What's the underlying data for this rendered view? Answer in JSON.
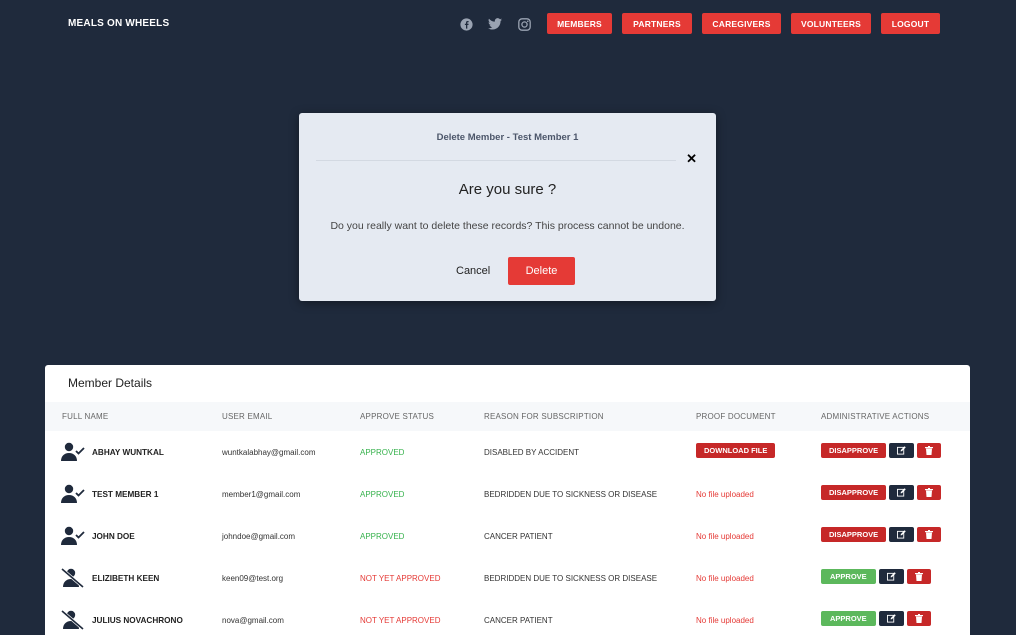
{
  "header": {
    "brand": "MEALS ON WHEELS",
    "social": [
      "facebook-icon",
      "twitter-icon",
      "instagram-icon"
    ],
    "nav": [
      "MEMBERS",
      "PARTNERS",
      "CAREGIVERS",
      "VOLUNTEERS",
      "LOGOUT"
    ]
  },
  "modal": {
    "title": "Delete Member - Test Member 1",
    "question": "Are you sure ?",
    "message": "Do you really want to delete these records? This process cannot be undone.",
    "cancel_label": "Cancel",
    "delete_label": "Delete"
  },
  "table": {
    "title": "Member Details",
    "columns": [
      "FULL NAME",
      "USER EMAIL",
      "APPROVE STATUS",
      "REASON FOR SUBSCRIPTION",
      "PROOF DOCUMENT",
      "ADMINISTRATIVE ACTIONS"
    ],
    "rows": [
      {
        "name": "ABHAY WUNTKAL",
        "email": "wuntkalabhay@gmail.com",
        "status": "APPROVED",
        "reason": "DISABLED BY ACCIDENT",
        "proof": "DOWNLOAD FILE",
        "action": "DISAPPROVE"
      },
      {
        "name": "TEST MEMBER 1",
        "email": "member1@gmail.com",
        "status": "APPROVED",
        "reason": "BEDRIDDEN DUE TO SICKNESS OR DISEASE",
        "proof": "No file uploaded",
        "action": "DISAPPROVE"
      },
      {
        "name": "JOHN DOE",
        "email": "johndoe@gmail.com",
        "status": "APPROVED",
        "reason": "CANCER PATIENT",
        "proof": "No file uploaded",
        "action": "DISAPPROVE"
      },
      {
        "name": "ELIZIBETH KEEN",
        "email": "keen09@test.org",
        "status": "NOT YET APPROVED",
        "reason": "BEDRIDDEN DUE TO SICKNESS OR DISEASE",
        "proof": "No file uploaded",
        "action": "APPROVE"
      },
      {
        "name": "JULIUS NOVACHRONO",
        "email": "nova@gmail.com",
        "status": "NOT YET APPROVED",
        "reason": "CANCER PATIENT",
        "proof": "No file uploaded",
        "action": "APPROVE"
      }
    ]
  }
}
